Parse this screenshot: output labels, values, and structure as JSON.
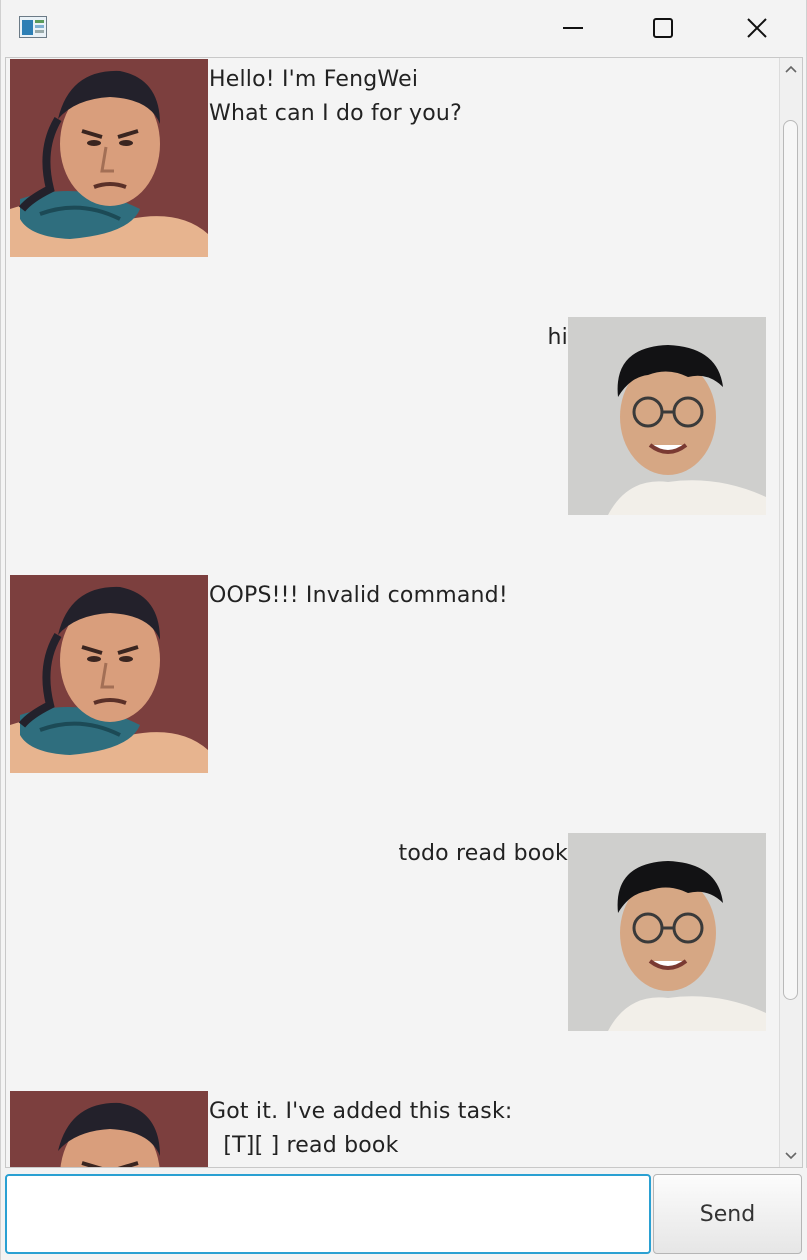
{
  "window": {
    "icon": "app-window-icon",
    "controls": {
      "minimize": "minimize-icon",
      "maximize": "maximize-icon",
      "close": "close-icon"
    }
  },
  "dialogs": [
    {
      "speaker": "bot",
      "avatar": "fengwei-avatar",
      "text": "Hello! I'm FengWei\nWhat can I do for you?"
    },
    {
      "speaker": "user",
      "avatar": "user-avatar",
      "text": "hi"
    },
    {
      "speaker": "bot",
      "avatar": "fengwei-avatar",
      "text": "OOPS!!! Invalid command!"
    },
    {
      "speaker": "user",
      "avatar": "user-avatar",
      "text": "todo read book"
    },
    {
      "speaker": "bot",
      "avatar": "fengwei-avatar",
      "text": "Got it. I've added this task:\n  [T][ ] read book"
    }
  ],
  "input": {
    "value": "",
    "placeholder": ""
  },
  "send_button": {
    "label": "Send"
  },
  "colors": {
    "accent": "#2aa0d2",
    "background": "#f4f4f4"
  }
}
